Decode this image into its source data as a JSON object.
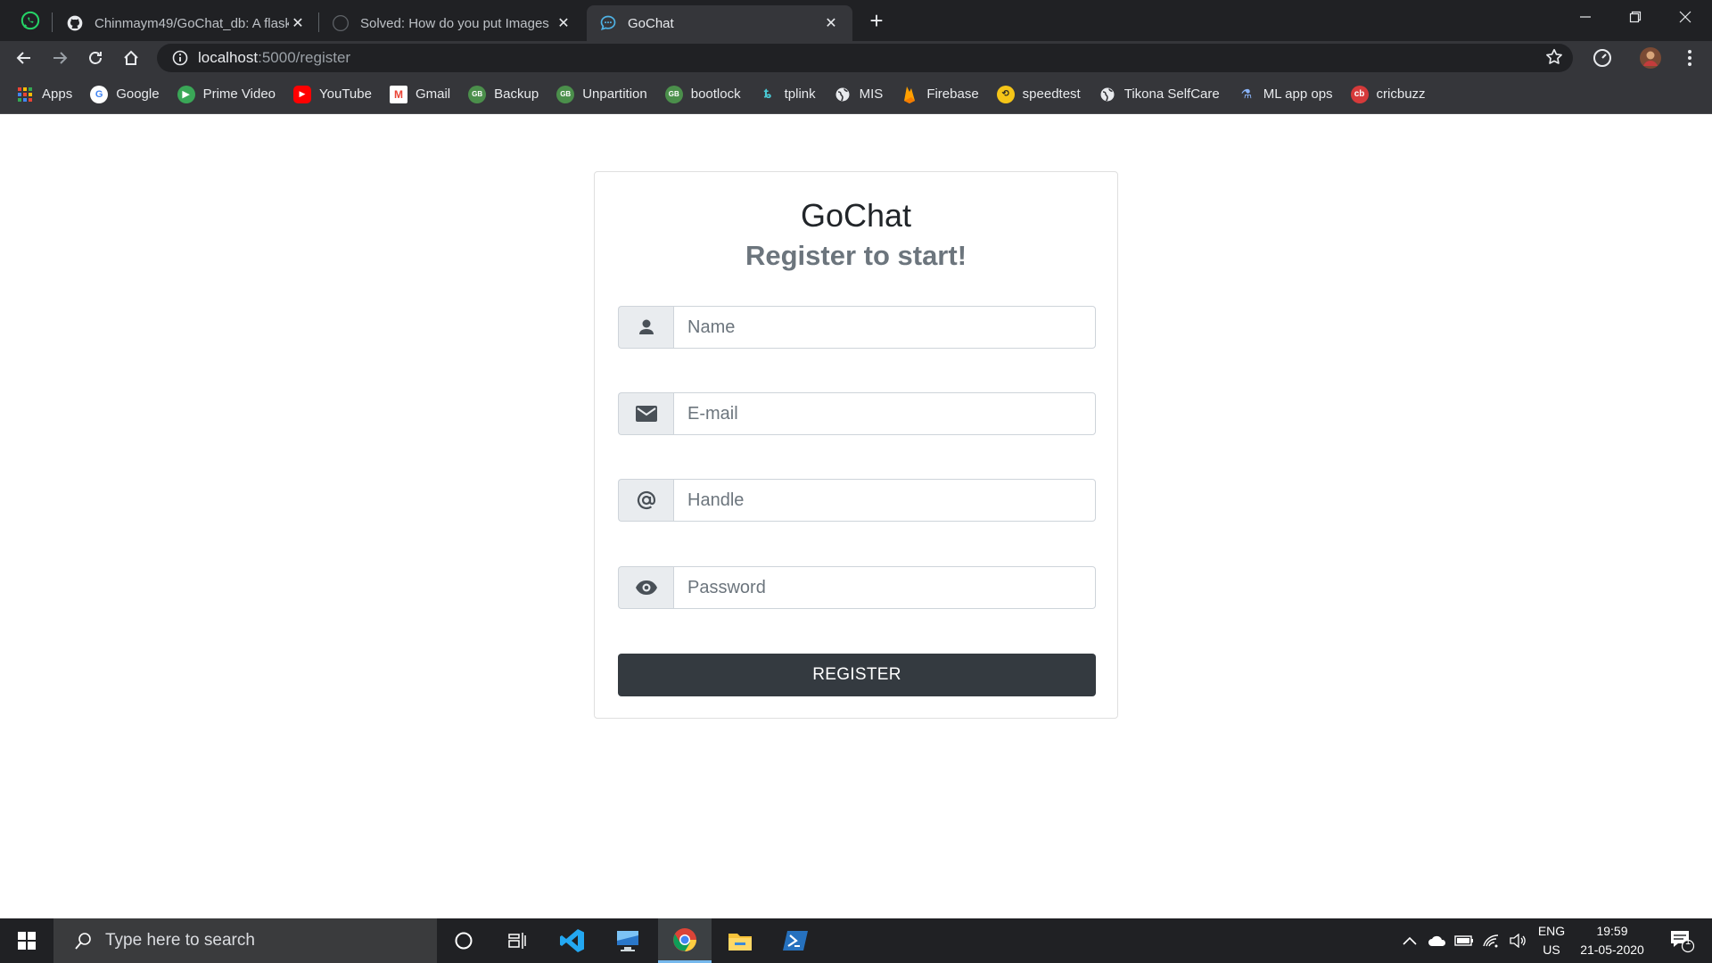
{
  "browser": {
    "tabs": [
      {
        "title": "Chinmaym49/GoChat_db: A flask",
        "icon": "github-icon"
      },
      {
        "title": "Solved: How do you put Images",
        "icon": "github-icon"
      },
      {
        "title": "GoChat",
        "icon": "chat-icon",
        "active": true
      }
    ],
    "pinned_tab_icon": "whatsapp-icon",
    "url_host": "localhost",
    "url_path": ":5000/register",
    "bookmarks": [
      {
        "label": "Apps",
        "icon": "apps-grid-icon",
        "color": "#e8eaed"
      },
      {
        "label": "Google",
        "icon": "google-icon",
        "color": "#ffffff"
      },
      {
        "label": "Prime Video",
        "icon": "play-icon",
        "color": "#3aa757"
      },
      {
        "label": "YouTube",
        "icon": "youtube-icon",
        "color": "#ff0000"
      },
      {
        "label": "Gmail",
        "icon": "gmail-icon",
        "color": "#ea4335"
      },
      {
        "label": "Backup",
        "icon": "web-app-icon",
        "color": "#4b8f4b"
      },
      {
        "label": "Unpartition",
        "icon": "web-app-icon",
        "color": "#4b8f4b"
      },
      {
        "label": "bootlock",
        "icon": "web-app-icon",
        "color": "#4b8f4b"
      },
      {
        "label": "tplink",
        "icon": "tplink-icon",
        "color": "#4acbd6"
      },
      {
        "label": "MIS",
        "icon": "globe-icon",
        "color": "#e8eaed"
      },
      {
        "label": "Firebase",
        "icon": "firebase-icon",
        "color": "#ffa000"
      },
      {
        "label": "speedtest",
        "icon": "speedtest-icon",
        "color": "#f5c518"
      },
      {
        "label": "Tikona SelfCare",
        "icon": "globe-icon",
        "color": "#e8eaed"
      },
      {
        "label": "ML app ops",
        "icon": "ml-icon",
        "color": "#8ab4f8"
      },
      {
        "label": "cricbuzz",
        "icon": "cricbuzz-icon",
        "color": "#d63a3a"
      }
    ]
  },
  "page": {
    "title": "GoChat",
    "subtitle": "Register to start!",
    "fields": [
      {
        "name": "name",
        "placeholder": "Name",
        "icon": "user-icon",
        "value": ""
      },
      {
        "name": "email",
        "placeholder": "E-mail",
        "icon": "envelope-icon",
        "value": ""
      },
      {
        "name": "handle",
        "placeholder": "Handle",
        "icon": "at-sign-icon",
        "value": ""
      },
      {
        "name": "password",
        "placeholder": "Password",
        "icon": "eye-icon",
        "value": ""
      }
    ],
    "register_label": "REGISTER"
  },
  "taskbar": {
    "search_placeholder": "Type here to search",
    "language_line1": "ENG",
    "language_line2": "US",
    "time": "19:59",
    "date": "21-05-2020",
    "notification_count": "1",
    "apps": [
      "cortana-icon",
      "task-view-icon",
      "vscode-icon",
      "remote-desktop-icon",
      "chrome-icon",
      "file-explorer-icon",
      "powershell-icon"
    ]
  },
  "colors": {
    "titlebar": "#202124",
    "toolbar": "#35363a",
    "button_dark": "#343a40",
    "addon_bg": "#e9ecef",
    "subtitle": "#6c757d"
  }
}
